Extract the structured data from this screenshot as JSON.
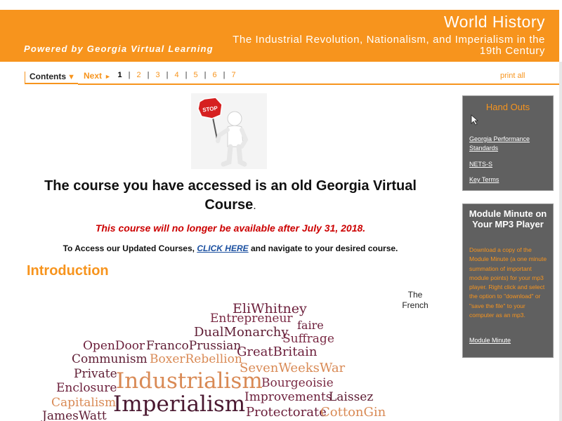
{
  "banner": {
    "title": "World History",
    "subtitle": "The Industrial Revolution, Nationalism, and Imperialism in the 19th Century",
    "powered_by": "Powered by Georgia Virtual Learning",
    "color": "#f7941d"
  },
  "nav": {
    "contents_label": "Contents",
    "contents_arrow": "▼",
    "next_label": "Next",
    "next_arrow": "►",
    "pages": [
      "1",
      "2",
      "3",
      "4",
      "5",
      "6",
      "7"
    ],
    "current_page": "1",
    "separator": "|",
    "print_all": "print all"
  },
  "main": {
    "stop_sign_text": "STOP",
    "heading": "The course you have accessed is an old Georgia Virtual Course",
    "heading_period": ".",
    "warning": "This course will no longer be available after July 31, 2018.",
    "access_prefix": "To Access our Updated Courses, ",
    "access_link": "CLICK HERE",
    "access_suffix": " and navigate to your desired course.",
    "intro_heading": "Introduction",
    "side_note": "The French"
  },
  "word_cloud": {
    "words": [
      "EliWhitney",
      "Entrepreneur",
      "faire",
      "DualMonarchy",
      "Suffrage",
      "OpenDoor",
      "FrancoPrussian",
      "GreatBritain",
      "Communism",
      "BoxerRebellion",
      "SevenWeeksWar",
      "Private",
      "Industrialism",
      "Bourgeoisie",
      "Enclosure",
      "Improvements",
      "Laissez",
      "Capitalism",
      "Imperialism",
      "Protectorate",
      "CottonGin",
      "JamesWatt"
    ]
  },
  "sidebar": {
    "handouts_title": "Hand Outs",
    "links": [
      "Georgia Performance Standards",
      "NETS-S",
      "Key Terms"
    ],
    "module_minute_title": "Module Minute on Your MP3 Player",
    "module_minute_text": "Download a copy of the Module Minute (a one minute summation of important module points) for your mp3 player. Right click and select the option to \"download\" or \"save the file\" to your computer as an mp3.",
    "module_minute_link": "Module Minute"
  }
}
